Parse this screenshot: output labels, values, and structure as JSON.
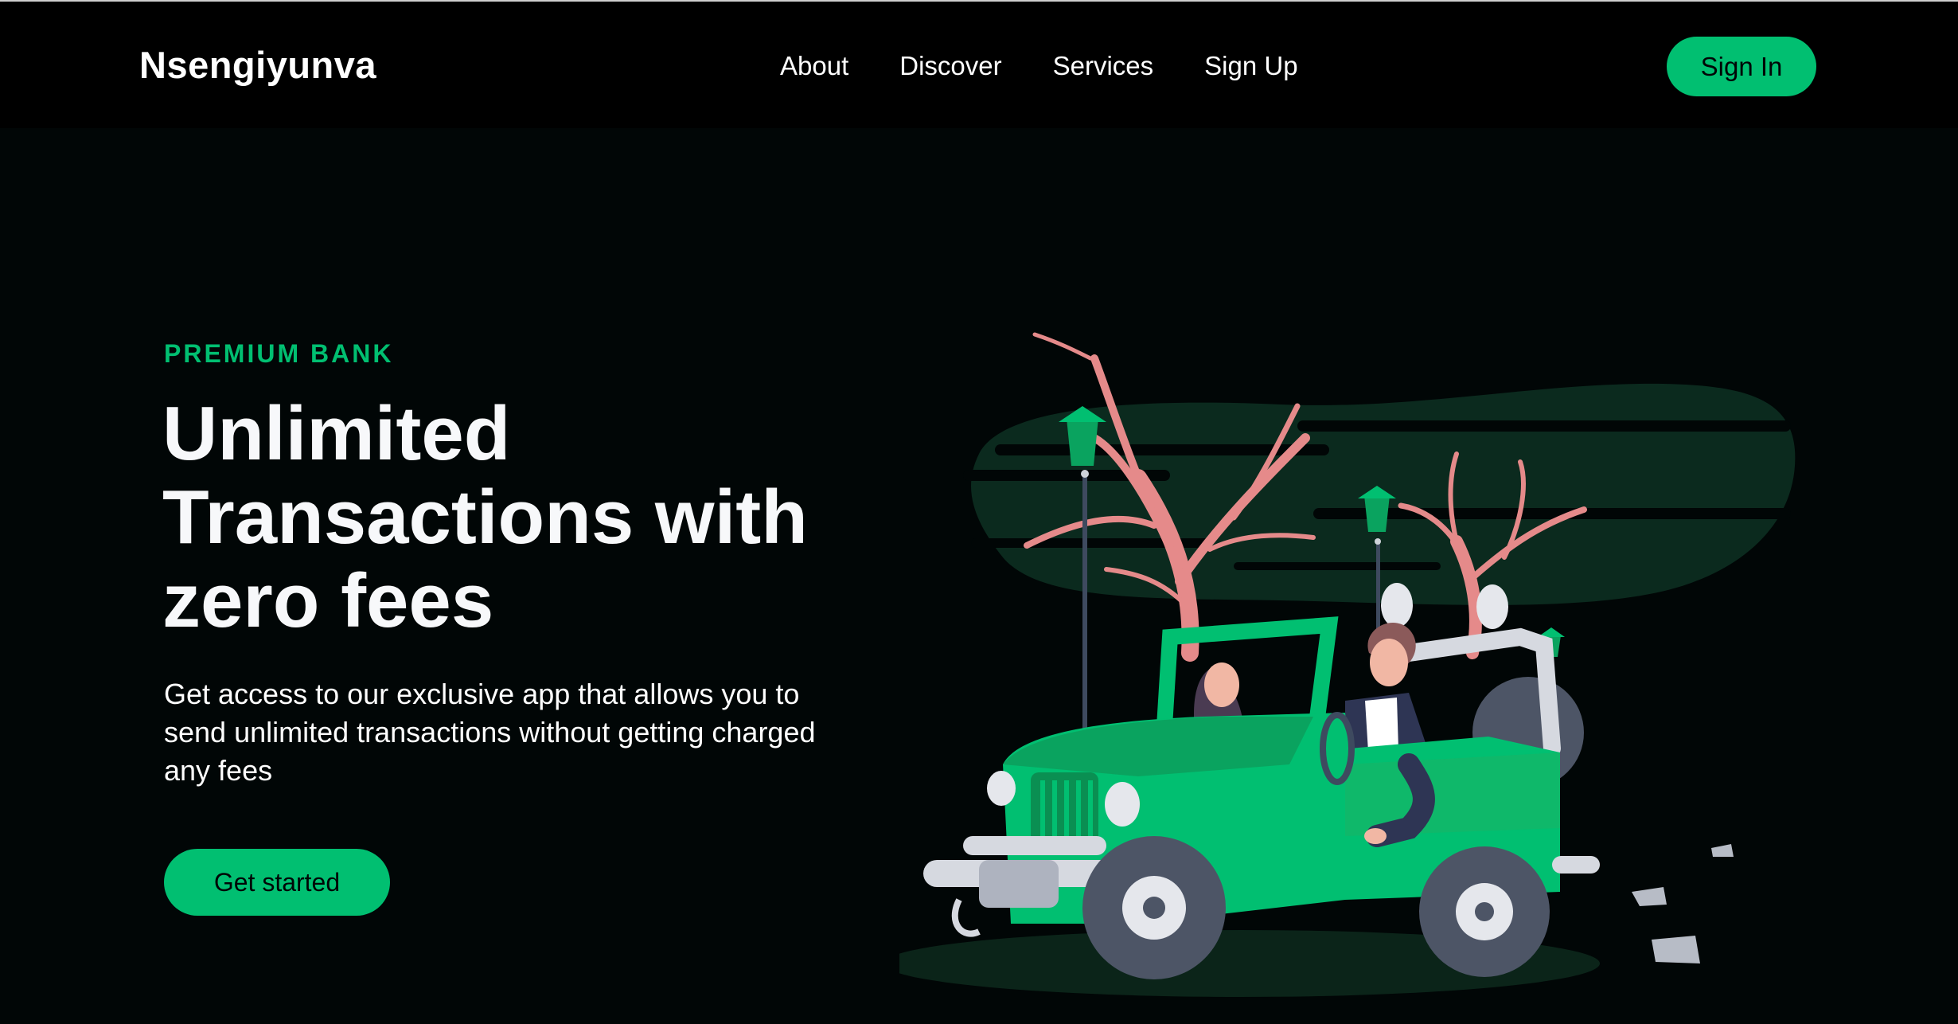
{
  "nav": {
    "logo": "Nsengiyunva",
    "items": [
      {
        "label": "About"
      },
      {
        "label": "Discover"
      },
      {
        "label": "Services"
      },
      {
        "label": "Sign Up"
      }
    ],
    "signin_label": "Sign In"
  },
  "hero": {
    "eyebrow": "PREMIUM BANK",
    "headline": "Unlimited Transactions with zero fees",
    "description": "Get access to our exclusive app that allows you to send unlimited transactions without getting charged any fees",
    "cta_label": "Get started",
    "illustration": "car-with-people-illustration"
  },
  "colors": {
    "background": "#010606",
    "nav_background": "#000000",
    "accent": "#01bf71",
    "text": "#ffffff",
    "tree": "#e58a8a",
    "lamp": "#01bf71"
  }
}
